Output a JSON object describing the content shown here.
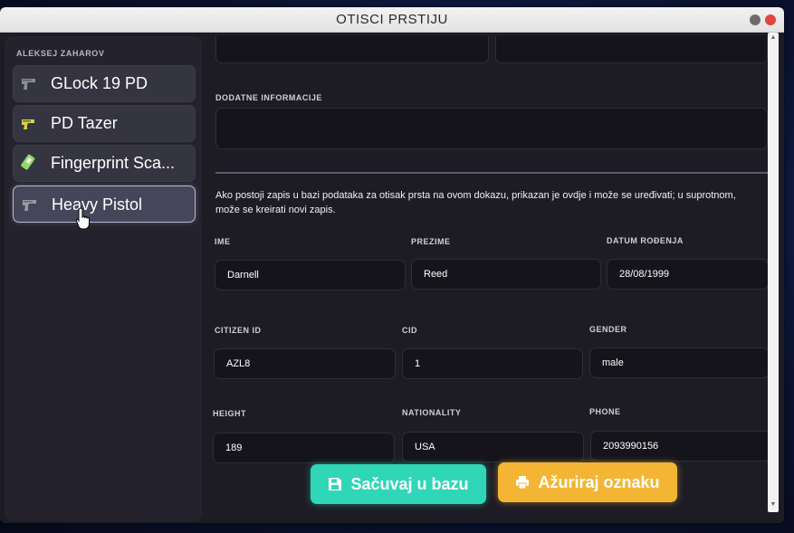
{
  "window": {
    "title": "OTISCI PRSTIJU"
  },
  "sidebar": {
    "owner": "ALEKSEJ ZAHAROV",
    "items": [
      {
        "label": "GLock 19 PD",
        "icon": "pistol-icon"
      },
      {
        "label": "PD Tazer",
        "icon": "taser-icon"
      },
      {
        "label": "Fingerprint Sca...",
        "icon": "fingerprint-scanner-icon"
      },
      {
        "label": "Heavy Pistol",
        "icon": "pistol-icon",
        "active": true
      }
    ]
  },
  "form": {
    "additional_info_label": "DODATNE INFORMACIJE",
    "info_text": "Ako postoji zapis u bazi podataka za otisak prsta na ovom dokazu, prikazan je ovdje i može se uređivati; u suprotnom, može se kreirati novi zapis.",
    "fields": {
      "first_name": {
        "label": "IME",
        "value": "Darnell"
      },
      "last_name": {
        "label": "PREZIME",
        "value": "Reed"
      },
      "dob": {
        "label": "DATUM ROĐENJA",
        "value": "28/08/1999"
      },
      "citizen_id": {
        "label": "CITIZEN ID",
        "value": "AZL8"
      },
      "cid": {
        "label": "CID",
        "value": "1"
      },
      "gender": {
        "label": "GENDER",
        "value": "male"
      },
      "height": {
        "label": "HEIGHT",
        "value": "189"
      },
      "nationality": {
        "label": "NATIONALITY",
        "value": "USA"
      },
      "phone": {
        "label": "PHONE",
        "value": "2093990156"
      }
    }
  },
  "actions": {
    "save_label": "Sačuvaj u bazu",
    "update_label": "Ažuriraj oznaku"
  },
  "colors": {
    "save": "#2fd6b7",
    "update": "#f3b533"
  }
}
